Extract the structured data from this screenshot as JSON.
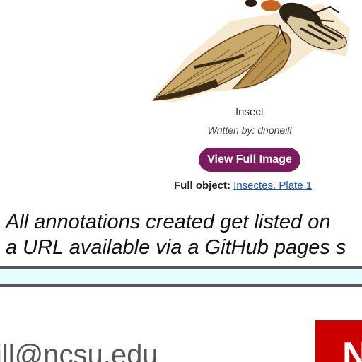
{
  "annotation_card": {
    "image_alt": "insect-illustration",
    "title": "Insect",
    "author_line": "Written by: dnoneill",
    "view_button": "View Full Image",
    "full_object_label": "Full object:",
    "full_object_link": "Insectes. Plate 1"
  },
  "paragraph": {
    "line1": "All annotations created get listed on",
    "line2": "a URL available via a GitHub pages s"
  },
  "footer": {
    "email_partial": "ill@ncsu.edu",
    "logo_letter": "N"
  },
  "colors": {
    "button": "#7d1c5c",
    "link": "#1a4fd6",
    "bar": "#e6fbfb",
    "logo": "#cc0000"
  }
}
